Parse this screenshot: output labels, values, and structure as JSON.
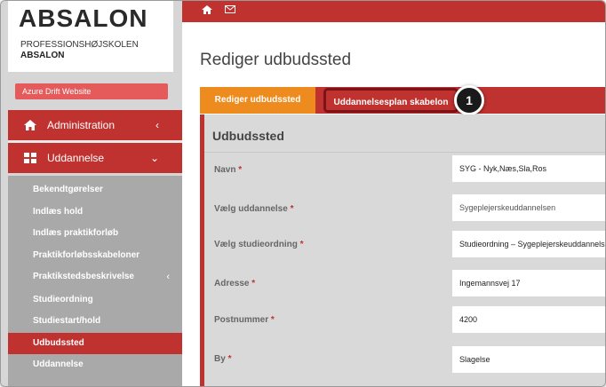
{
  "brand": {
    "logo": "ABSALON",
    "line1": "PROFESSIONSHØJSKOLEN",
    "line2": "ABSALON"
  },
  "azure_button": "Azure Drift Website",
  "nav": {
    "administration": "Administration",
    "uddannelse": "Uddannelse",
    "sub_items": [
      "Bekendtgørelser",
      "Indlæs hold",
      "Indlæs praktikforløb",
      "Praktikforløbsskabeloner",
      "Praktikstedsbeskrivelse",
      "Studieordning",
      "Studiestart/hold",
      "Udbudssted",
      "Uddannelse"
    ],
    "active_item": "Udbudssted"
  },
  "page": {
    "title": "Rediger udbudssted"
  },
  "tabs": {
    "tab1": "Rediger udbudssted",
    "tab2": "Uddannelsesplan skabelon",
    "callout": "1"
  },
  "form": {
    "heading": "Udbudssted",
    "required_mark": "*",
    "fields": [
      {
        "label": "Navn",
        "value": "SYG - Nyk,Næs,Sla,Ros"
      },
      {
        "label": "Vælg uddannelse",
        "value": "Sygeplejerskeuddannelsen"
      },
      {
        "label": "Vælg studieordning",
        "value": "Studieordning – Sygeplejerskeuddannelsen"
      },
      {
        "label": "Adresse",
        "value": "Ingemannsvej 17"
      },
      {
        "label": "Postnummer",
        "value": "4200"
      },
      {
        "label": "By",
        "value": "Slagelse"
      }
    ]
  },
  "colors": {
    "primary_red": "#c0322f",
    "tab_orange": "#ee8b1e",
    "sidebar_gray": "#a9a9a9"
  }
}
